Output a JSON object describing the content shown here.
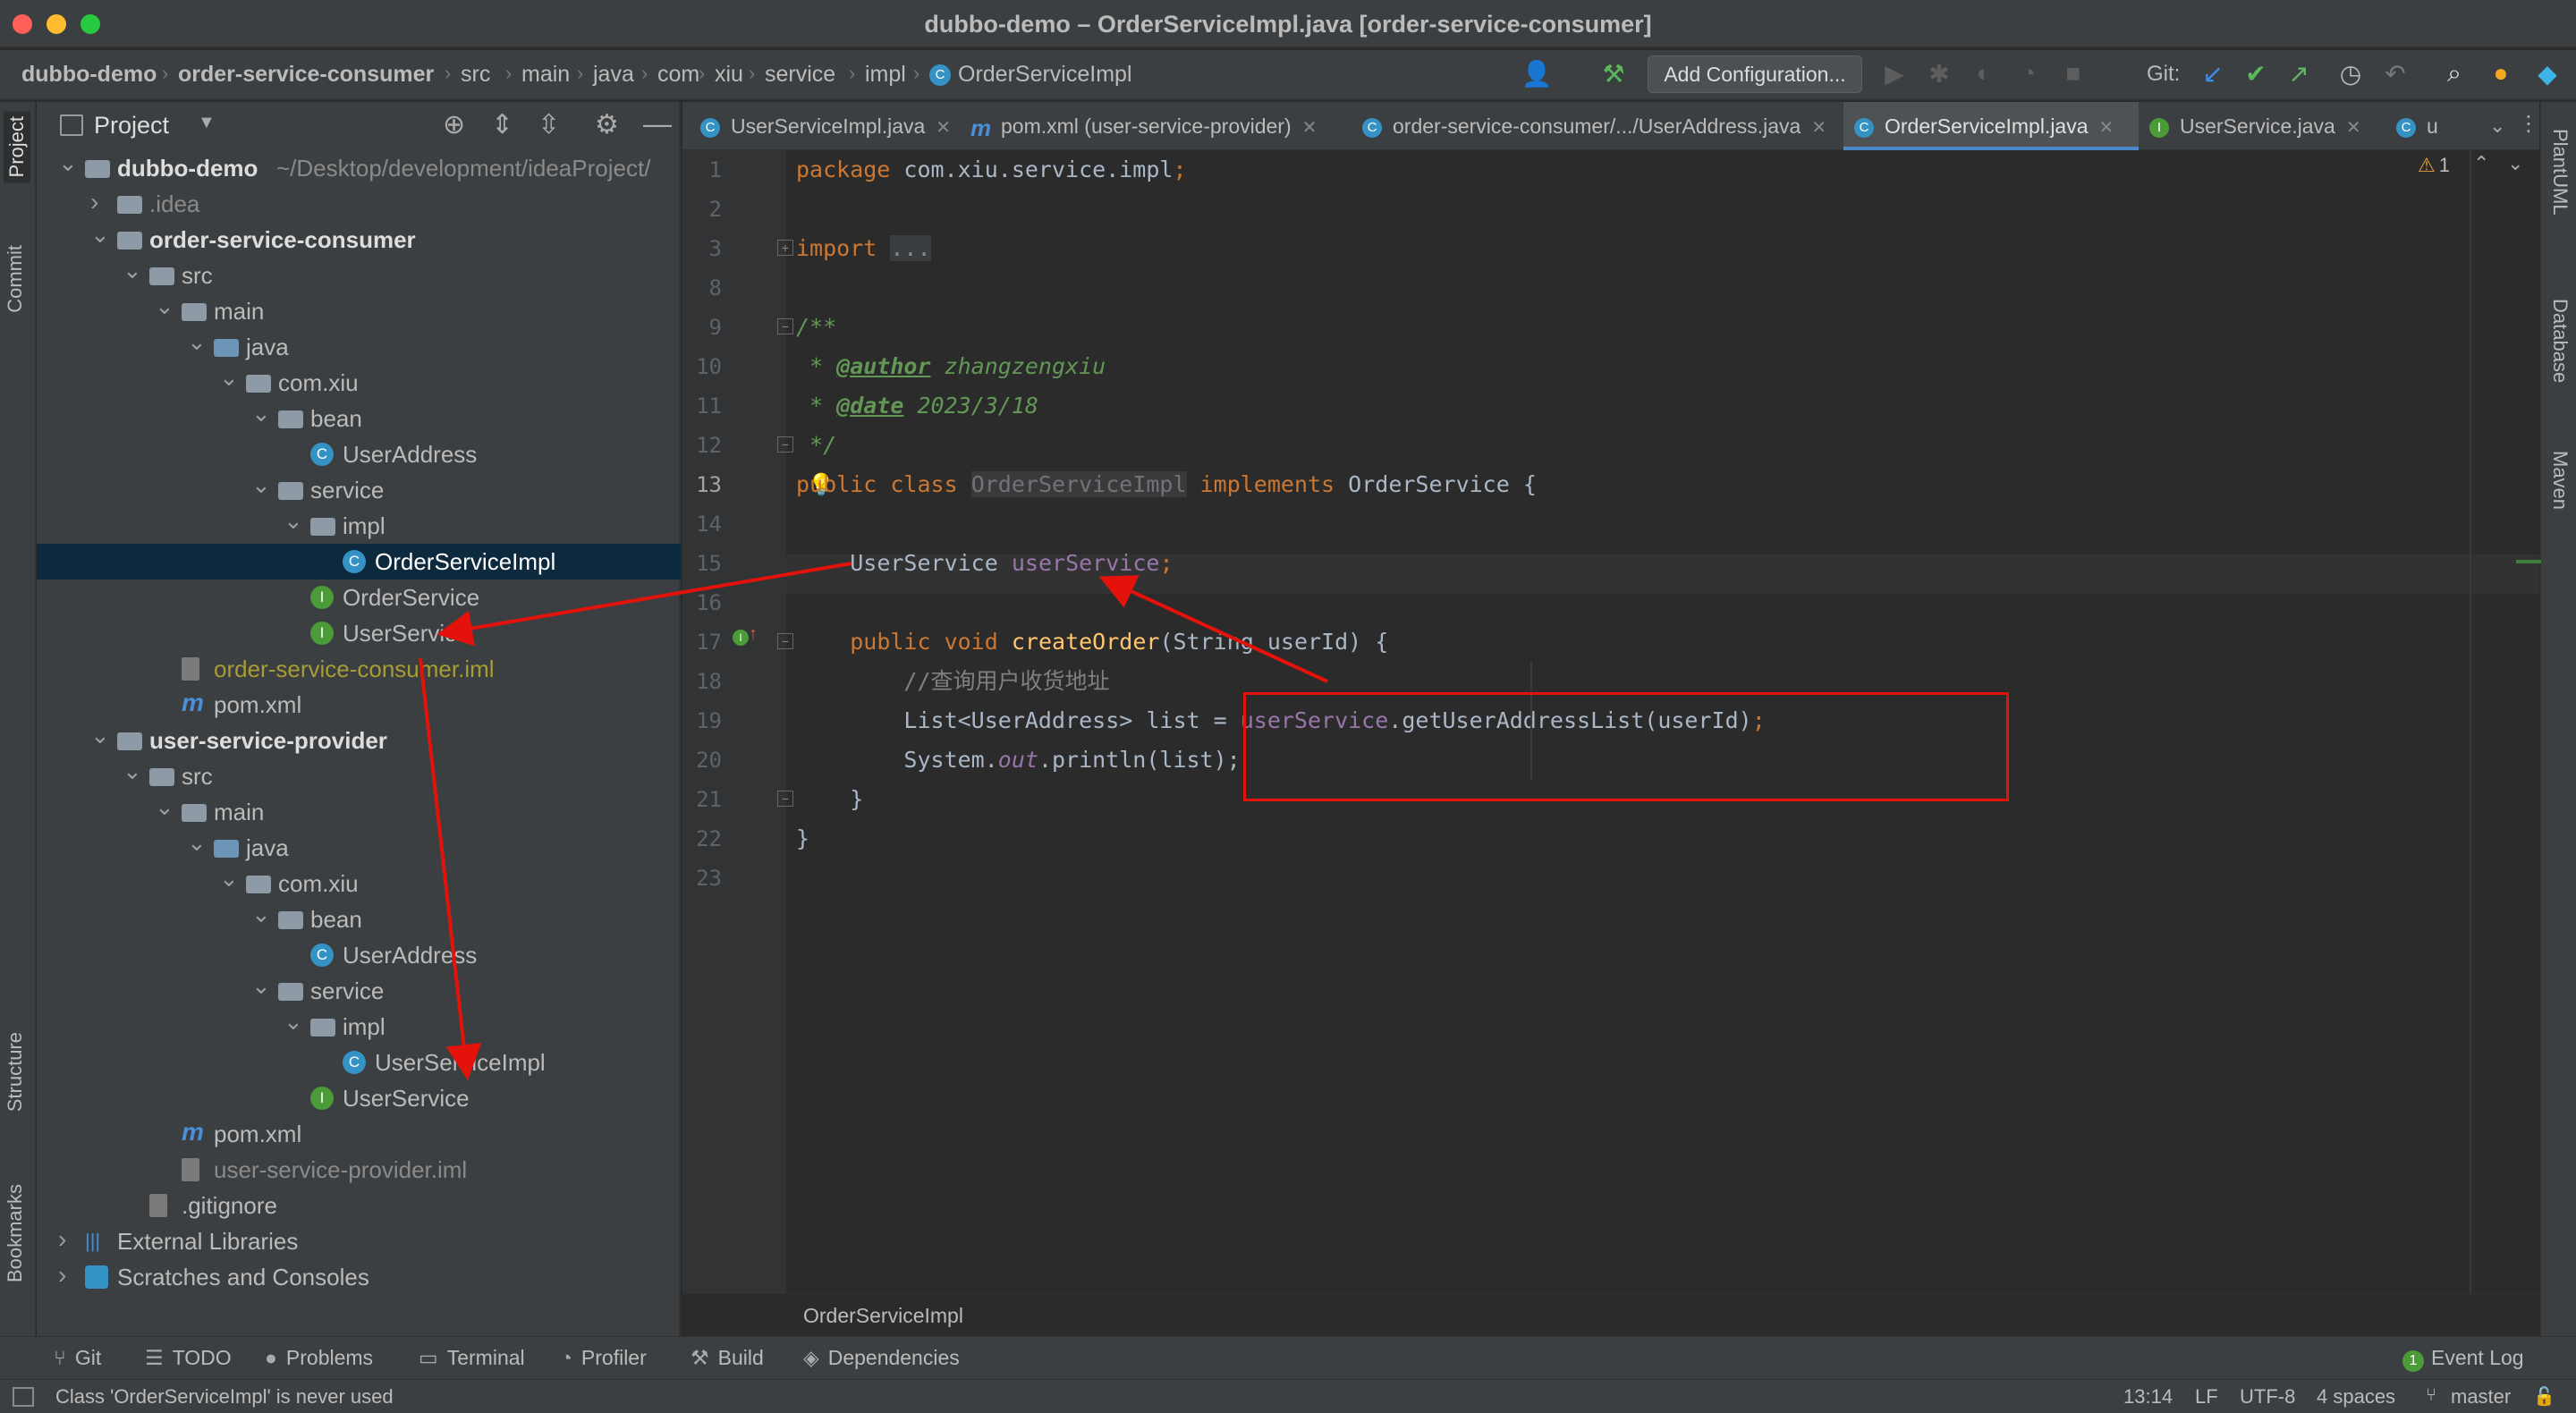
{
  "window": {
    "title": "dubbo-demo – OrderServiceImpl.java [order-service-consumer]"
  },
  "breadcrumb": [
    "dubbo-demo",
    "order-service-consumer",
    "src",
    "main",
    "java",
    "com",
    "xiu",
    "service",
    "impl",
    "OrderServiceImpl"
  ],
  "toolbar": {
    "add_config": "Add Configuration...",
    "git_label": "Git:"
  },
  "left_strip": [
    "Project",
    "Commit",
    "Structure",
    "Bookmarks"
  ],
  "right_strip": [
    "PlantUML",
    "Database",
    "Maven"
  ],
  "project": {
    "header": "Project",
    "tree": [
      {
        "label": "dubbo-demo",
        "extra": "~/Desktop/development/ideaProject/",
        "depth": 0,
        "icon": "module",
        "arrow": "down",
        "bold": true
      },
      {
        "label": ".idea",
        "depth": 1,
        "icon": "folder",
        "arrow": "right",
        "muted": true
      },
      {
        "label": "order-service-consumer",
        "depth": 1,
        "icon": "module",
        "arrow": "down",
        "bold": true
      },
      {
        "label": "src",
        "depth": 2,
        "icon": "folder",
        "arrow": "down"
      },
      {
        "label": "main",
        "depth": 3,
        "icon": "folder",
        "arrow": "down"
      },
      {
        "label": "java",
        "depth": 4,
        "icon": "src",
        "arrow": "down"
      },
      {
        "label": "com.xiu",
        "depth": 5,
        "icon": "package",
        "arrow": "down"
      },
      {
        "label": "bean",
        "depth": 6,
        "icon": "package",
        "arrow": "down"
      },
      {
        "label": "UserAddress",
        "depth": 7,
        "icon": "class"
      },
      {
        "label": "service",
        "depth": 6,
        "icon": "package",
        "arrow": "down"
      },
      {
        "label": "impl",
        "depth": 7,
        "icon": "package",
        "arrow": "down"
      },
      {
        "label": "OrderServiceImpl",
        "depth": 8,
        "icon": "class",
        "selected": true
      },
      {
        "label": "OrderService",
        "depth": 7,
        "icon": "interface"
      },
      {
        "label": "UserService",
        "depth": 7,
        "icon": "interface"
      },
      {
        "label": "order-service-consumer.iml",
        "depth": 3,
        "icon": "file",
        "color": "#a89c34"
      },
      {
        "label": "pom.xml",
        "depth": 3,
        "icon": "maven"
      },
      {
        "label": "user-service-provider",
        "depth": 1,
        "icon": "module",
        "arrow": "down",
        "bold": true
      },
      {
        "label": "src",
        "depth": 2,
        "icon": "folder",
        "arrow": "down"
      },
      {
        "label": "main",
        "depth": 3,
        "icon": "folder",
        "arrow": "down"
      },
      {
        "label": "java",
        "depth": 4,
        "icon": "src",
        "arrow": "down"
      },
      {
        "label": "com.xiu",
        "depth": 5,
        "icon": "package",
        "arrow": "down"
      },
      {
        "label": "bean",
        "depth": 6,
        "icon": "package",
        "arrow": "down"
      },
      {
        "label": "UserAddress",
        "depth": 7,
        "icon": "class"
      },
      {
        "label": "service",
        "depth": 6,
        "icon": "package",
        "arrow": "down"
      },
      {
        "label": "impl",
        "depth": 7,
        "icon": "package",
        "arrow": "down"
      },
      {
        "label": "UserServiceImpl",
        "depth": 8,
        "icon": "class"
      },
      {
        "label": "UserService",
        "depth": 7,
        "icon": "interface"
      },
      {
        "label": "pom.xml",
        "depth": 3,
        "icon": "maven"
      },
      {
        "label": "user-service-provider.iml",
        "depth": 3,
        "icon": "file",
        "color": "#8a8a8a"
      },
      {
        "label": ".gitignore",
        "depth": 2,
        "icon": "file"
      },
      {
        "label": "External Libraries",
        "depth": 0,
        "icon": "libs",
        "arrow": "right"
      },
      {
        "label": "Scratches and Consoles",
        "depth": 0,
        "icon": "scratch",
        "arrow": "right"
      }
    ]
  },
  "tabs": [
    {
      "label": "UserServiceImpl.java",
      "icon": "C"
    },
    {
      "label": "pom.xml (user-service-provider)",
      "icon": "m"
    },
    {
      "label": "order-service-consumer/.../UserAddress.java",
      "icon": "C"
    },
    {
      "label": "OrderServiceImpl.java",
      "icon": "C",
      "active": true
    },
    {
      "label": "UserService.java",
      "icon": "I"
    },
    {
      "label": "u",
      "icon": "C"
    }
  ],
  "editor": {
    "warning_count": "1",
    "line_numbers": [
      "1",
      "2",
      "3",
      "8",
      "9",
      "10",
      "11",
      "12",
      "13",
      "14",
      "15",
      "16",
      "17",
      "18",
      "19",
      "20",
      "21",
      "22",
      "23"
    ],
    "code_line_1": "package com.xiu.service.impl;",
    "import_kw": "import",
    "import_fold": "...",
    "doc_open": "/**",
    "doc_author_tag": "@author",
    "doc_author": "zhangzengxiu",
    "doc_date_tag": "@date",
    "doc_date": "2023/3/18",
    "doc_close": " */",
    "class_decl": {
      "public": "public",
      "class": "class",
      "name": "OrderServiceImpl",
      "implements": "implements",
      "iface": "OrderService {"
    },
    "field": {
      "type": "UserService",
      "name": "userService",
      "semi": ";"
    },
    "method": {
      "mods": "public void",
      "name": "createOrder",
      "params": "(String userId) {"
    },
    "comment": "//查询用户收货地址",
    "stmt1": {
      "type": "List<UserAddress> list = ",
      "recv": "userService",
      "call": ".getUserAddressList(userId)",
      "semi": ";"
    },
    "stmt2": {
      "pre": "System.",
      "out": "out",
      "post": ".println(list);"
    },
    "close_method": "}",
    "close_class": "}",
    "crumb": "OrderServiceImpl"
  },
  "bottom_tools": [
    "Git",
    "TODO",
    "Problems",
    "Terminal",
    "Profiler",
    "Build",
    "Dependencies"
  ],
  "event_log": "Event Log",
  "status": {
    "message": "Class 'OrderServiceImpl' is never used",
    "position": "13:14",
    "line_sep": "LF",
    "encoding": "UTF-8",
    "indent": "4 spaces",
    "branch": "master"
  }
}
